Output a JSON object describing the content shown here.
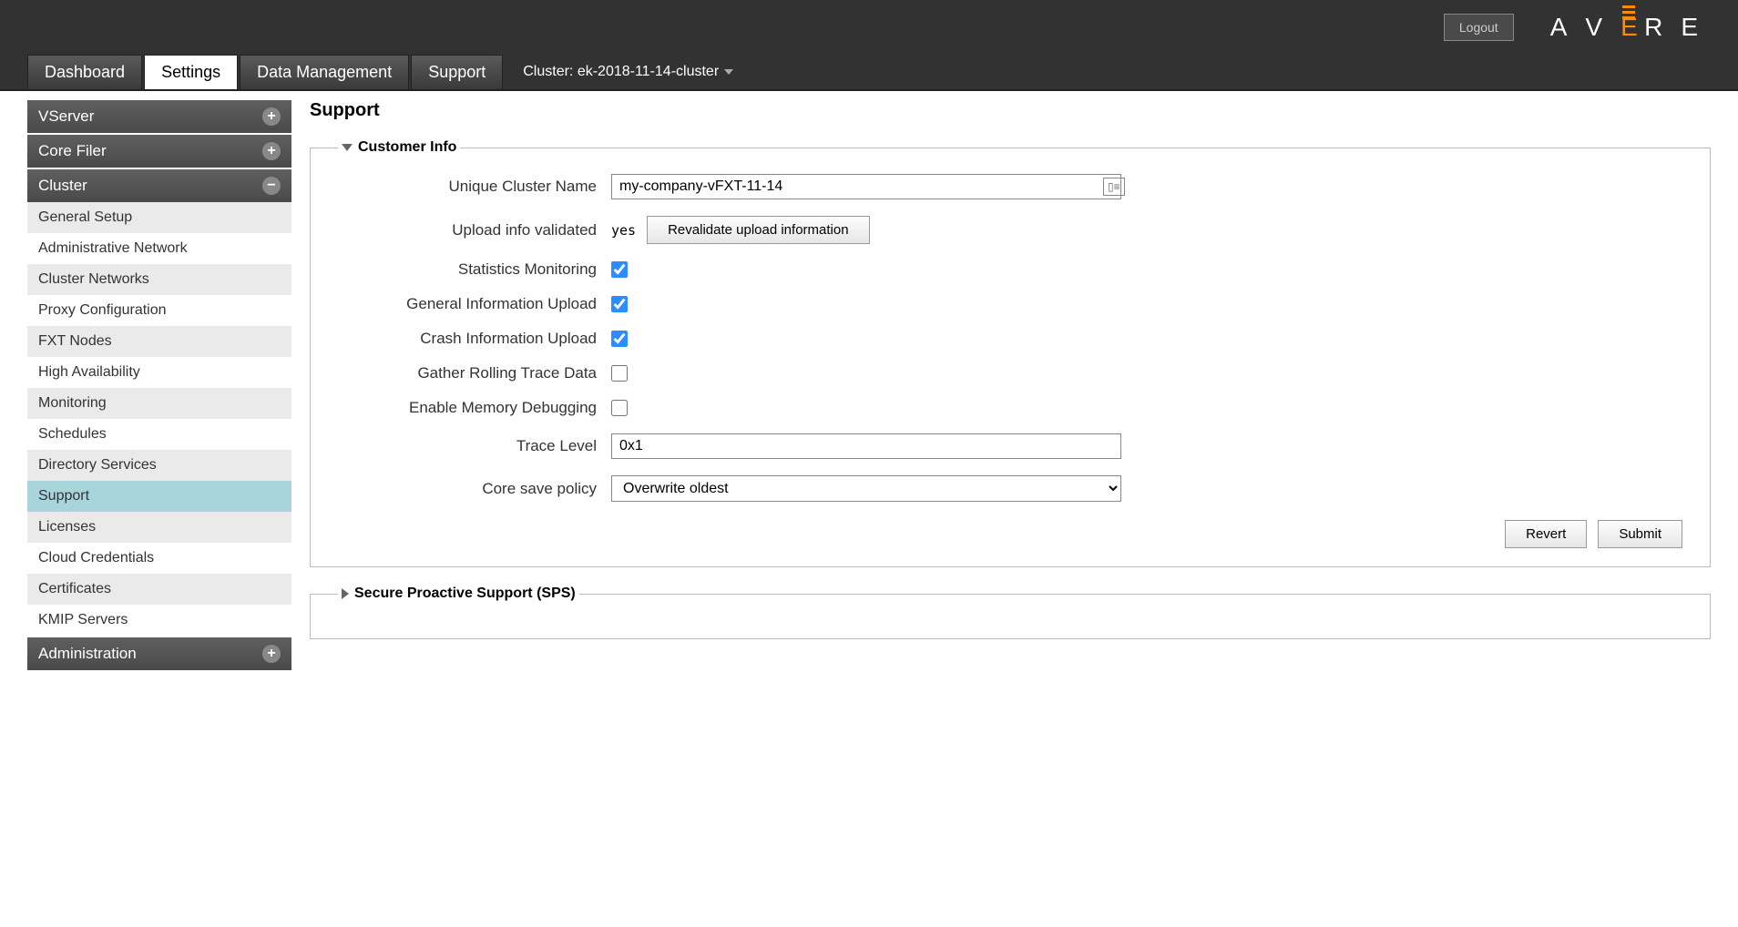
{
  "topbar": {
    "logout": "Logout"
  },
  "tabs": {
    "dashboard": "Dashboard",
    "settings": "Settings",
    "data_management": "Data Management",
    "support": "Support",
    "cluster_label": "Cluster: ek-2018-11-14-cluster"
  },
  "sidebar": {
    "sections": {
      "vserver": "VServer",
      "corefiler": "Core Filer",
      "cluster": "Cluster",
      "administration": "Administration"
    },
    "cluster_items": [
      "General Setup",
      "Administrative Network",
      "Cluster Networks",
      "Proxy Configuration",
      "FXT Nodes",
      "High Availability",
      "Monitoring",
      "Schedules",
      "Directory Services",
      "Support",
      "Licenses",
      "Cloud Credentials",
      "Certificates",
      "KMIP Servers"
    ]
  },
  "page": {
    "title": "Support",
    "customer_info_legend": "Customer Info",
    "sps_legend": "Secure Proactive Support (SPS)",
    "labels": {
      "cluster_name": "Unique Cluster Name",
      "upload_validated": "Upload info validated",
      "stats": "Statistics Monitoring",
      "gen_upload": "General Information Upload",
      "crash_upload": "Crash Information Upload",
      "rolling": "Gather Rolling Trace Data",
      "memdbg": "Enable Memory Debugging",
      "trace": "Trace Level",
      "core_save": "Core save policy"
    },
    "values": {
      "cluster_name": "my-company-vFXT-11-14",
      "upload_validated": "yes",
      "trace": "0x1",
      "core_save": "Overwrite oldest"
    },
    "buttons": {
      "revalidate": "Revalidate upload information",
      "revert": "Revert",
      "submit": "Submit"
    }
  }
}
